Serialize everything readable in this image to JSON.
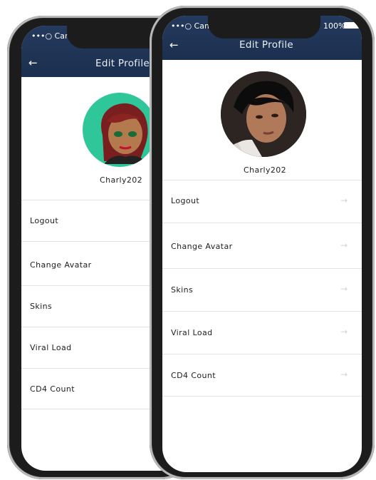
{
  "phones": [
    {
      "status_carrier": "•••○ Cam",
      "nav": {
        "title": "Edit Profile",
        "back_icon": "arrow-left-icon"
      },
      "profile": {
        "username": "Charly202",
        "avatar": "cartoon-avatar-woman"
      },
      "menu": [
        {
          "label": "Logout"
        },
        {
          "label": "Change Avatar"
        },
        {
          "label": "Skins"
        },
        {
          "label": "Viral Load"
        },
        {
          "label": "CD4 Count"
        }
      ]
    },
    {
      "status_carrier": "•••○ Cam",
      "status_battery": "100%",
      "nav": {
        "title": "Edit Profile",
        "back_icon": "arrow-left-icon"
      },
      "profile": {
        "username": "Charly202",
        "avatar": "photo-avatar-man"
      },
      "menu": [
        {
          "label": "Logout",
          "icon": "arrow-right-icon"
        },
        {
          "label": "Change Avatar",
          "icon": "arrow-right-icon"
        },
        {
          "label": "Skins",
          "icon": "arrow-right-icon"
        },
        {
          "label": "Viral Load",
          "icon": "arrow-right-icon"
        },
        {
          "label": "CD4 Count",
          "icon": "arrow-right-icon"
        }
      ]
    }
  ],
  "colors": {
    "navbar": "#1f3356",
    "avatar_bg_left": "#2fc79a",
    "divider": "#e2e2e2",
    "arrow": "#cfd6de"
  }
}
